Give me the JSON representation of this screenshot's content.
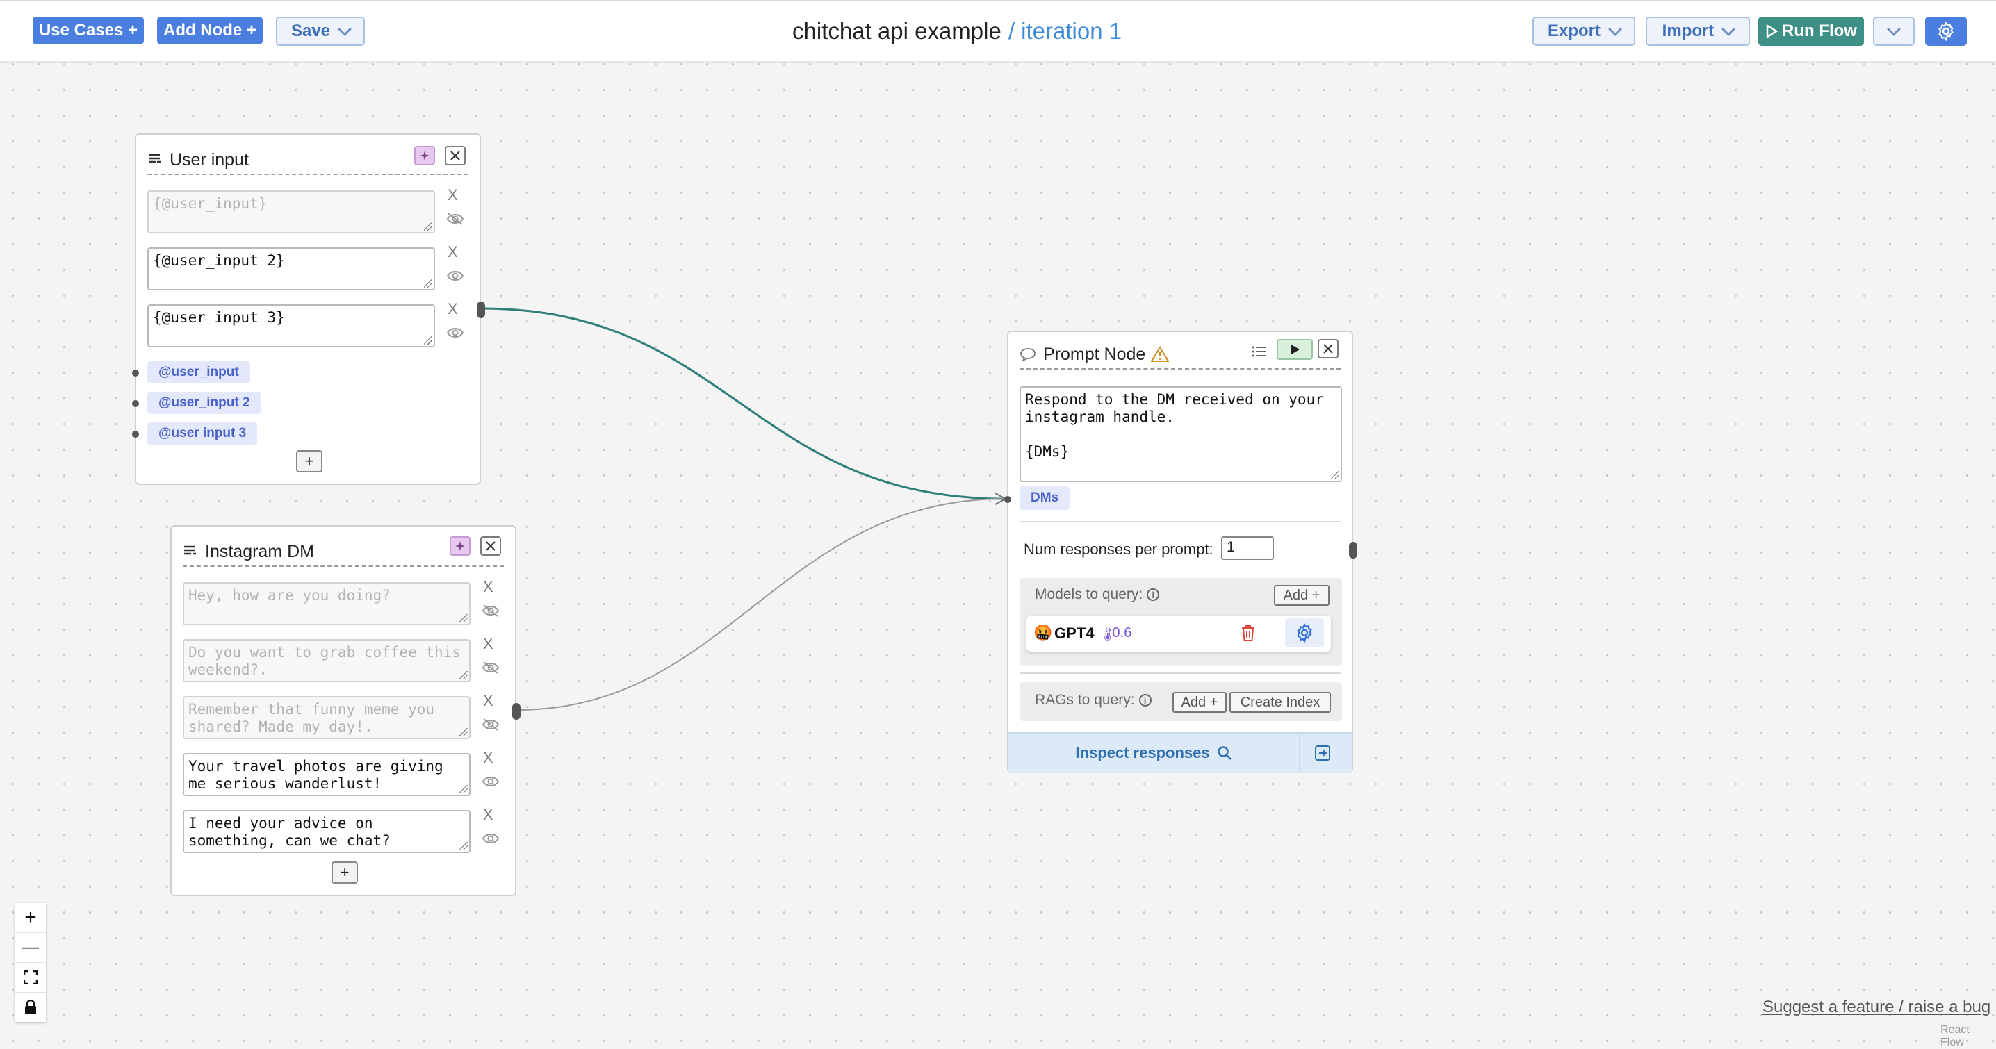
{
  "toolbar": {
    "use_cases": "Use Cases +",
    "add_node": "Add Node +",
    "save": "Save",
    "title": "chitchat api example",
    "iteration": "/ iteration 1",
    "export": "Export",
    "import": "Import",
    "run_flow": "Run Flow"
  },
  "user_input_node": {
    "title": "User input",
    "fields": [
      {
        "value": "{@user_input}",
        "visible": false
      },
      {
        "value": "{@user_input 2}",
        "visible": true
      },
      {
        "value": "{@user input 3}",
        "visible": true
      }
    ],
    "tags": [
      "@user_input",
      "@user_input 2",
      "@user input 3"
    ],
    "add_label": "+",
    "remove_label": "X"
  },
  "instagram_node": {
    "title": "Instagram DM",
    "fields": [
      {
        "value": "Hey, how are you doing?",
        "visible": false
      },
      {
        "value": "Do you want to grab coffee this weekend?.",
        "visible": false
      },
      {
        "value": "Remember that funny meme you shared? Made my day!.",
        "visible": false
      },
      {
        "value": "Your travel photos are giving me serious wanderlust!",
        "visible": true
      },
      {
        "value": "I need your advice on something, can we chat?",
        "visible": true
      }
    ],
    "add_label": "+",
    "remove_label": "X"
  },
  "prompt_node": {
    "title": "Prompt Node",
    "prompt_text": "Respond to the DM received on your instagram handle.\n\n{DMs}",
    "var_tag": "DMs",
    "num_responses_label": "Num responses per prompt:",
    "num_responses_value": "1",
    "models_label": "Models to query:",
    "add_model": "Add +",
    "model": {
      "emoji": "🤬",
      "name": "GPT4",
      "temp_icon": "🌡",
      "temp": ":0.6"
    },
    "rags_label": "RAGs to query:",
    "add_rag": "Add +",
    "create_index": "Create Index",
    "inspect": "Inspect responses"
  },
  "zoom": {
    "zoom_in": "+",
    "zoom_out": "—"
  },
  "footer": {
    "suggest": "Suggest a feature / raise a bug",
    "attribution": "React Flow"
  },
  "colors": {
    "edge_active": "#2e7f7a",
    "edge_idle": "#9a9a9a",
    "run_button": "#3e8f85",
    "primary_button": "#4a7fe0"
  }
}
